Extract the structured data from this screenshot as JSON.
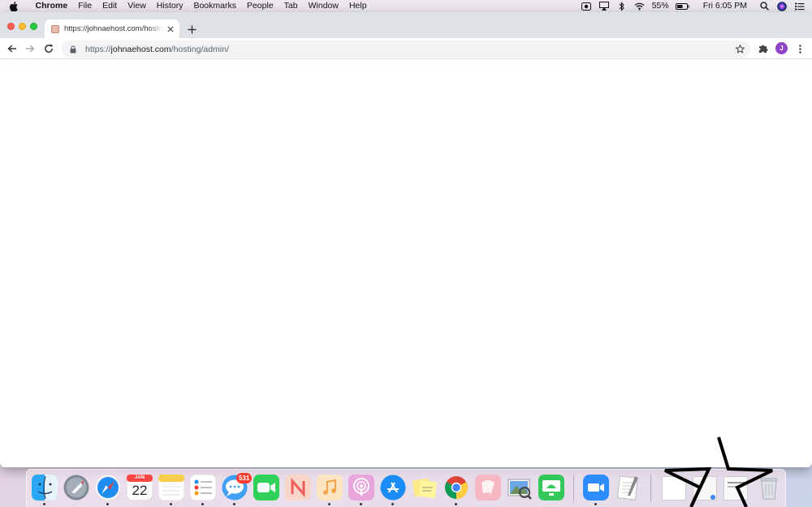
{
  "menubar": {
    "app_name": "Chrome",
    "items": [
      "File",
      "Edit",
      "View",
      "History",
      "Bookmarks",
      "People",
      "Tab",
      "Window",
      "Help"
    ],
    "battery": "55%",
    "clock": "Fri 6:05 PM"
  },
  "browser": {
    "tab_title": "https://johnaehost.com/hosting/admin/",
    "url": {
      "scheme": "https://",
      "host": "johnaehost.com",
      "path": "/hosting/admin/"
    },
    "avatar_initial": "J"
  },
  "dock": {
    "apps": [
      {
        "name": "finder",
        "running": true
      },
      {
        "name": "launchpad",
        "running": false
      },
      {
        "name": "safari",
        "running": true
      },
      {
        "name": "calendar",
        "running": false,
        "month": "JAN",
        "day": "22"
      },
      {
        "name": "notes",
        "running": true
      },
      {
        "name": "reminders",
        "running": true
      },
      {
        "name": "messages",
        "running": true,
        "badge": "531"
      },
      {
        "name": "facetime",
        "running": false
      },
      {
        "name": "news",
        "running": false
      },
      {
        "name": "music",
        "running": true
      },
      {
        "name": "podcasts",
        "running": true
      },
      {
        "name": "app-store",
        "running": true
      },
      {
        "name": "stickies",
        "running": false
      },
      {
        "name": "chrome",
        "running": true
      },
      {
        "name": "pink-app",
        "running": false
      },
      {
        "name": "preview",
        "running": false
      },
      {
        "name": "screen-sharing",
        "running": false
      },
      {
        "name": "zoom",
        "running": true
      },
      {
        "name": "textedit",
        "running": false
      }
    ]
  },
  "colors": {
    "tabstrip": "#dee1e6",
    "omnibox": "#f1f3f4",
    "avatar": "#8e44c4",
    "badge": "#ff3b30"
  }
}
